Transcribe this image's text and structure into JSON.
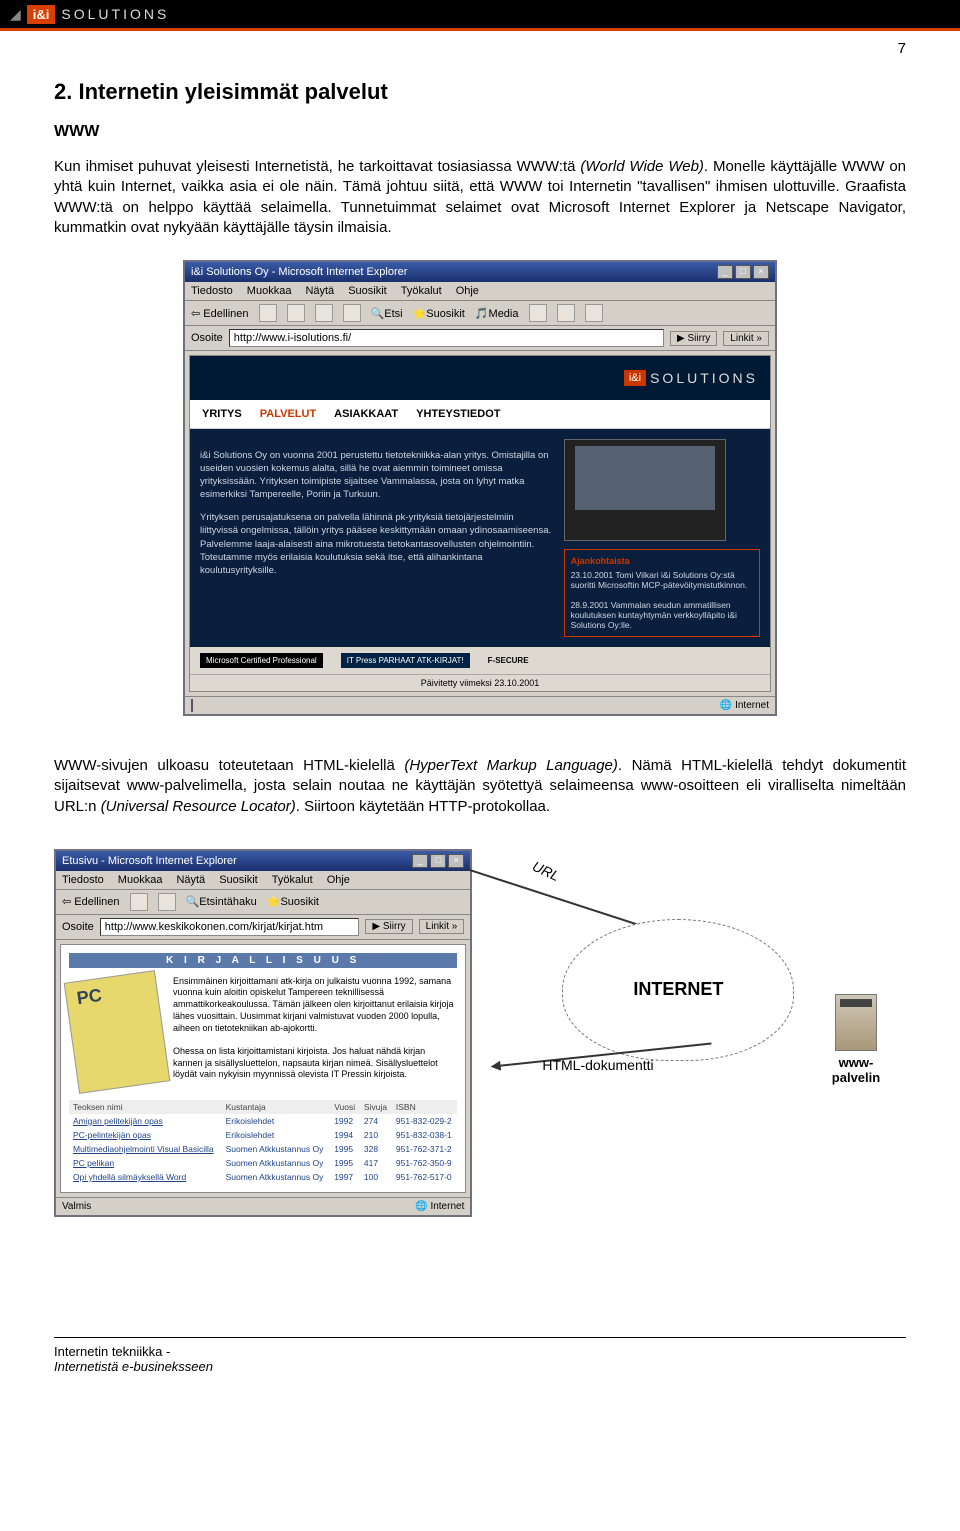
{
  "header": {
    "logo_box": "i&i",
    "logo_text": "SOLUTIONS"
  },
  "page_number": "7",
  "title": "2. Internetin yleisimmät palvelut",
  "subheading": "WWW",
  "para1_a": "Kun ihmiset puhuvat yleisesti Internetistä, he tarkoittavat tosiasiassa WWW:tä ",
  "para1_i": "(World Wide Web)",
  "para1_b": ". Monelle käyttäjälle WWW on yhtä kuin Internet, vaikka asia ei ole näin. Tämä johtuu siitä, että WWW toi Internetin \"tavallisen\" ihmisen ulottuville. Graafista WWW:tä on helppo käyttää selaimella. Tunnetuimmat selaimet ovat Microsoft Internet Explorer ja Netscape Navigator, kummatkin ovat nykyään käyttäjälle täysin ilmaisia.",
  "browser1": {
    "title": "i&i Solutions Oy - Microsoft Internet Explorer",
    "menu": [
      "Tiedosto",
      "Muokkaa",
      "Näytä",
      "Suosikit",
      "Työkalut",
      "Ohje"
    ],
    "toolbar": {
      "back": "Edellinen",
      "etsi": "Etsi",
      "suosikit": "Suosikit",
      "media": "Media"
    },
    "addr_label": "Osoite",
    "address": "http://www.i-isolutions.fi/",
    "go": "Siirry",
    "links": "Linkit",
    "status_text": "Internet",
    "nav": {
      "a": "YRITYS",
      "b": "PALVELUT",
      "c": "ASIAKKAAT",
      "d": "YHTEYSTIEDOT"
    },
    "site_p1": "i&i Solutions Oy on vuonna 2001 perustettu tietotekniikka-alan yritys. Omistajilla on useiden vuosien kokemus alalta, sillä he ovat aiemmin toimineet omissa yrityksissään. Yrityksen toimipiste sijaitsee Vammalassa, josta on lyhyt matka esimerkiksi Tampereelle, Poriin ja Turkuun.",
    "site_p2": "Yrityksen perusajatuksena on palvella lähinnä pk-yrityksiä tietojärjestelmiin liittyvissä ongelmissa, tällöin yritys pääsee keskittymään omaan ydinosaamiseensa. Palvelemme laaja-alaisesti aina mikrotuesta tietokantasovellusten ohjelmointiin. Toteutamme myös erilaisia koulutuksia sekä itse, että alihankintana koulutusyrityksille.",
    "side_title": "Ajankohtaista",
    "side_item1": "23.10.2001 Tomi Vilkari i&i Solutions Oy:stä suoritti Microsoftin MCP-pätevöitymistutkinnon.",
    "side_item2": "28.9.2001 Vammalan seudun ammatillisen koulutuksen kuntayhtymän verkkoylläpito i&i Solutions Oy:lle.",
    "cert1": "Microsoft Certified Professional",
    "cert2": "IT Press PARHAAT ATK-KIRJAT!",
    "cert3": "F-SECURE",
    "updated": "Päivitetty viimeksi 23.10.2001"
  },
  "para2_a": "WWW-sivujen ulkoasu toteutetaan HTML-kielellä ",
  "para2_i1": "(HyperText Markup Language)",
  "para2_b": ". Nämä HTML-kielellä tehdyt dokumentit sijaitsevat www-palvelimella, josta selain noutaa ne käyttäjän syötettyä selaimeensa www-osoitteen eli viralliselta nimeltään URL:n ",
  "para2_i2": "(Universal Resource Locator)",
  "para2_c": ". Siirtoon käytetään HTTP-protokollaa.",
  "browser2": {
    "title": "Etusivu - Microsoft Internet Explorer",
    "menu": [
      "Tiedosto",
      "Muokkaa",
      "Näytä",
      "Suosikit",
      "Työkalut",
      "Ohje"
    ],
    "toolbar": {
      "back": "Edellinen",
      "etsintahaku": "Etsintähaku",
      "suosikit": "Suosikit"
    },
    "addr_label": "Osoite",
    "address": "http://www.keskikokonen.com/kirjat/kirjat.htm",
    "go": "Siirry",
    "links": "Linkit",
    "banner": "K I R J A L L I S U U S",
    "body_text": "Ensimmäinen kirjoittamani atk-kirja on julkaistu vuonna 1992, samana vuonna kuin aloitin opiskelut Tampereen teknillisessä ammattikorkeakoulussa. Tämän jälkeen olen kirjoittanut erilaisia kirjoja lähes vuosittain. Uusimmat kirjani valmistuvat vuoden 2000 lopulla, aiheen on tietotekniikan ab-ajokortti.",
    "body_text2": "Ohessa on lista kirjoittamistani kirjoista. Jos haluat nähdä kirjan kannen ja sisällysluettelon, napsauta kirjan nimeä. Sisällysluettelot löydät vain nykyisin myynnissä olevista IT Pressin kirjoista.",
    "table_headers": [
      "Teoksen nimi",
      "Kustantaja",
      "Vuosi",
      "Sivuja",
      "ISBN"
    ],
    "table_rows": [
      [
        "Amigan pelitekijän opas",
        "Erikoislehdet",
        "1992",
        "274",
        "951-832-029-2"
      ],
      [
        "PC-pelintekijän opas",
        "Erikoislehdet",
        "1994",
        "210",
        "951-832-038-1"
      ],
      [
        "Multimediaohjelmointi Visual Basicilla",
        "Suomen Atkkustannus Oy",
        "1995",
        "328",
        "951-762-371-2"
      ],
      [
        "PC pelikan",
        "Suomen Atkkustannus Oy",
        "1995",
        "417",
        "951-762-350-9"
      ],
      [
        "Opi yhdellä silmäyksellä Word",
        "Suomen Atkkustannus Oy",
        "1997",
        "100",
        "951-762-517-0"
      ]
    ],
    "status": "Valmis",
    "status_text": "Internet"
  },
  "diagram": {
    "url": "URL",
    "cloud": "INTERNET",
    "html_doc": "HTML-dokumentti",
    "server": "www-palvelin"
  },
  "footer": {
    "line1": "Internetin tekniikka -",
    "line2": "Internetistä e-busineksseen"
  }
}
